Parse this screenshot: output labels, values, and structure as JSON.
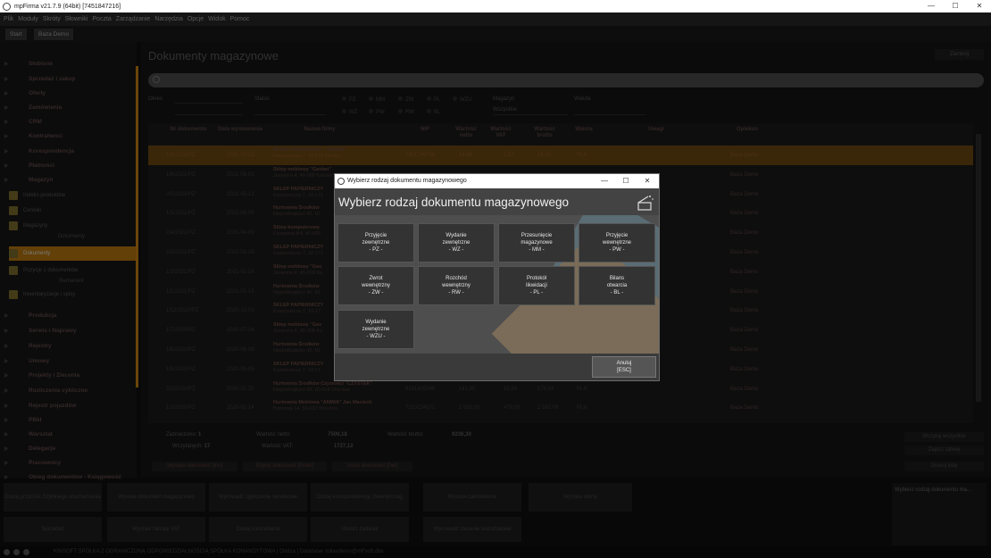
{
  "window": {
    "title": "mpFirma v21.7.9 (64bit) [7451847216]",
    "minimize": "—",
    "maximize": "☐",
    "close": "✕"
  },
  "menu": [
    "Plik",
    "Moduły",
    "Skróty",
    "Słowniki",
    "Poczta",
    "Zarządzanie",
    "Narzędzia",
    "Opcje",
    "Widok",
    "Pomoc"
  ],
  "tabs": [
    "Start",
    "Baza Demo"
  ],
  "sidebar": {
    "top_groups": [
      "Słubisne",
      "Sprzedaż i zakup",
      "Oferty",
      "Zamówienia",
      "CRM",
      "Kontrahenci",
      "Korespondencja",
      "Płatności",
      "Magazyn"
    ],
    "magazyn_items": [
      {
        "label": "Indeks produktów",
        "head": ""
      },
      {
        "label": "Cenniki",
        "head": ""
      },
      {
        "label": "Magazyny",
        "head": "Dokumenty"
      },
      {
        "label": "Dokumenty",
        "head": ""
      },
      {
        "label": "Pozycje z dokumentów",
        "head": "Remanent"
      },
      {
        "label": "Inwentaryzacje i spisy",
        "head": ""
      }
    ],
    "bottom_groups": [
      "Produkcja",
      "Serwis i Naprawy",
      "Rejestry",
      "Umowy",
      "Projekty i Zlecenia",
      "Rozliczenia cykliczne",
      "Rejestr pojazdów",
      "PBkI",
      "Warsztat",
      "Delegacje",
      "Pracownicy",
      "Obieg dokumentów - Księgowość"
    ]
  },
  "main": {
    "title": "Dokumenty magazynowe",
    "close_label": "Zamknij",
    "filters": {
      "okres_label": "Okres",
      "status_label": "Status",
      "magazyn_label": "Magazyn",
      "magazyn_value": "Wszystkie",
      "waluta_label": "Waluta",
      "types_row1": [
        "PZ",
        "MM",
        "ZW",
        "PL",
        "WZU"
      ],
      "types_row2": [
        "WZ",
        "PW",
        "RW",
        "BL"
      ]
    },
    "columns": [
      "Nr dokumentu",
      "Data wystawienia",
      "Nazwa firmy",
      "NIP",
      "Wartość netto",
      "Wartość VAT",
      "Wartość brutto",
      "Waluta",
      "Uwagi",
      "Opiekun"
    ],
    "rows": [
      {
        "nr": "1/3/2021/PZ",
        "data": "2021-07-12",
        "firma": "SKLEP PAPIERNICZY \"FRANK\"",
        "adres": "Kasprowicza 7, 10-171 Olsztyn",
        "nip": "7451749748",
        "netto": "14,66",
        "vat": "3,37",
        "brutto": "18,03",
        "waluta": "PLN",
        "opiekun": "Baza Demo",
        "sel": true
      },
      {
        "nr": "1/8/2021/PZ",
        "data": "2021-06-01",
        "firma": "Sklep meblowy \"Gavlan\"",
        "adres": "Jesienna 4, 40-008 Katowice",
        "nip": "",
        "netto": "",
        "vat": "",
        "brutto": "",
        "waluta": "",
        "opiekun": "Baza Demo",
        "sel": false
      },
      {
        "nr": "2/5/2021/PZ",
        "data": "2021-05-12",
        "firma": "SKLEP PAPIERNICZY",
        "adres": "Kasprowicza 7, 10-171",
        "nip": "",
        "netto": "",
        "vat": "",
        "brutto": "",
        "waluta": "",
        "opiekun": "Baza Demo",
        "sel": false
      },
      {
        "nr": "1/5/2021/PZ",
        "data": "2021-05-05",
        "firma": "Hurtownia Środków",
        "adres": "Niepodległości 45, 50",
        "nip": "",
        "netto": "",
        "vat": "",
        "brutto": "",
        "waluta": "",
        "opiekun": "Baza Demo",
        "sel": false
      },
      {
        "nr": "2/4/2021/PZ",
        "data": "2021-04-09",
        "firma": "Sklep komputerowy",
        "adres": "Księgowa 8/4, 80-006",
        "nip": "",
        "netto": "",
        "vat": "",
        "brutto": "",
        "waluta": "",
        "opiekun": "Baza Demo",
        "sel": false
      },
      {
        "nr": "2/3/2021/PZ",
        "data": "2021-03-29",
        "firma": "SKLEP PAPIERNICZY",
        "adres": "Kasprowicza 7, 10-171",
        "nip": "",
        "netto": "",
        "vat": "",
        "brutto": "",
        "waluta": "",
        "opiekun": "Baza Demo",
        "sel": false
      },
      {
        "nr": "1/2/2021/PZ",
        "data": "2021-02-16",
        "firma": "Sklep meblowy \"Gav",
        "adres": "Jesienna 4, 40-008 Ka",
        "nip": "",
        "netto": "",
        "vat": "",
        "brutto": "",
        "waluta": "",
        "opiekun": "Baza Demo",
        "sel": false
      },
      {
        "nr": "1/1/2021/PZ",
        "data": "2021-01-15",
        "firma": "Hurtownia Środków",
        "adres": "Niepodległości 45, 50",
        "nip": "",
        "netto": "",
        "vat": "",
        "brutto": "",
        "waluta": "",
        "opiekun": "Baza Demo",
        "sel": false
      },
      {
        "nr": "1/12/2020/PZ",
        "data": "2020-12-03",
        "firma": "SKLEP PAPIERNICZY",
        "adres": "Kasprowicza 7, 10-17",
        "nip": "",
        "netto": "",
        "vat": "",
        "brutto": "",
        "waluta": "",
        "opiekun": "Baza Demo",
        "sel": false
      },
      {
        "nr": "1/7/2020/PZ",
        "data": "2020-07-04",
        "firma": "Sklep meblowy \"Gav",
        "adres": "Jesienna 4, 40-008 Ka",
        "nip": "",
        "netto": "",
        "vat": "",
        "brutto": "",
        "waluta": "",
        "opiekun": "Baza Demo",
        "sel": false
      },
      {
        "nr": "1/6/2020/PZ",
        "data": "2020-06-08",
        "firma": "Hurtownia Środków",
        "adres": "Niepodległości 45, 50",
        "nip": "",
        "netto": "",
        "vat": "",
        "brutto": "",
        "waluta": "",
        "opiekun": "Baza Demo",
        "sel": false
      },
      {
        "nr": "1/5/2020/PZ",
        "data": "2020-05-05",
        "firma": "SKLEP PAPIERNICZY",
        "adres": "Kasprowicza 7, 10-17",
        "nip": "",
        "netto": "",
        "vat": "",
        "brutto": "",
        "waluta": "",
        "opiekun": "Baza Demo",
        "sel": false
      },
      {
        "nr": "2/2/2020/PZ",
        "data": "2020-02-20",
        "firma": "Hurtownia Środków Czystości \"CZYSTEK\"",
        "adres": "Niepodległości 45, 50-004 Wrocław",
        "nip": "6191425066",
        "netto": "141,90",
        "vat": "32,64",
        "brutto": "174,54",
        "waluta": "PLN",
        "opiekun": "Baza Demo",
        "sel": false
      },
      {
        "nr": "1/2/2020/PZ",
        "data": "2020-02-14",
        "firma": "Hurtownia Meblowa \"ANIMA\" Jan Maciech",
        "adres": "Bronowa 14, 50-032 Wrocław",
        "nip": "7153134571",
        "netto": "2 083,00",
        "vat": "479,09",
        "brutto": "2 562,09",
        "waluta": "PLN",
        "opiekun": "Baza Demo",
        "sel": false
      }
    ],
    "summary": {
      "zaznaczono_label": "Zaznaczono:",
      "zaznaczono": "1",
      "wczytanych_label": "Wczytanych:",
      "wczytanych": "17",
      "netto_label": "Wartość netto:",
      "netto": "7509,18",
      "vat_label": "Wartość VAT:",
      "vat": "1727,12",
      "brutto_label": "Wartość brutto:",
      "brutto": "9236,30"
    },
    "actions": [
      "Wystaw dokument [Ins]",
      "Edytuj dokument [Enter]",
      "Usuń dokument [Del]"
    ],
    "side_buttons": [
      "Wczytaj wszystkie",
      "Zapisz tabelę",
      "Drukuj listę"
    ]
  },
  "quick": [
    "Dodaj przyciski Szybkiego uruchamiania",
    "Wystaw dokument magazynowy",
    "Wprowadź zgłoszenie serwisowe",
    "Dodaj korespondencję (zewnętrzną)",
    "Wystaw zamówienie",
    "Wystaw ofertę",
    "Sprzedaż",
    "Wystaw fakturę VAT",
    "Dodaj kontrahenta",
    "Utwórz zadanie",
    "Wprowadź zlecenie warsztatowe"
  ],
  "preview_title": "Wybierz rodzaj dokumentu ma...",
  "statusbar": "KINSOFT SPÓŁKA Z OGRANICZONĄ ODPOWIEDZIALNOŚCIĄ SPÓŁKA KOMANDYTOWA | Orldza | Database: tollavdemo@mFsoft.dbs",
  "dialog": {
    "window_title": "Wybierz rodzaj dokumentu magazynowego",
    "heading": "Wybierz rodzaj dokumentu magazynowego",
    "buttons": [
      {
        "l1": "Przyjęcie",
        "l2": "zewnętrzne",
        "l3": "- PZ -"
      },
      {
        "l1": "Wydanie",
        "l2": "zewnętrzne",
        "l3": "- WZ -"
      },
      {
        "l1": "Przesunięcie",
        "l2": "magazynowe",
        "l3": "- MM -"
      },
      {
        "l1": "Przyjęcie",
        "l2": "wewnętrzne",
        "l3": "- PW -"
      },
      {
        "l1": "Zwrot",
        "l2": "wewnętrzny",
        "l3": "- ZW -"
      },
      {
        "l1": "Rozchód",
        "l2": "wewnętrzny",
        "l3": "- RW -"
      },
      {
        "l1": "Protokół",
        "l2": "likwidacji",
        "l3": "- PL -"
      },
      {
        "l1": "Bilans",
        "l2": "otwarcia",
        "l3": "- BL -"
      },
      {
        "l1": "Wydanie",
        "l2": "zewnętrzne",
        "l3": "- WZU -"
      }
    ],
    "cancel_l1": "Anuluj",
    "cancel_l2": "[ESC]"
  }
}
